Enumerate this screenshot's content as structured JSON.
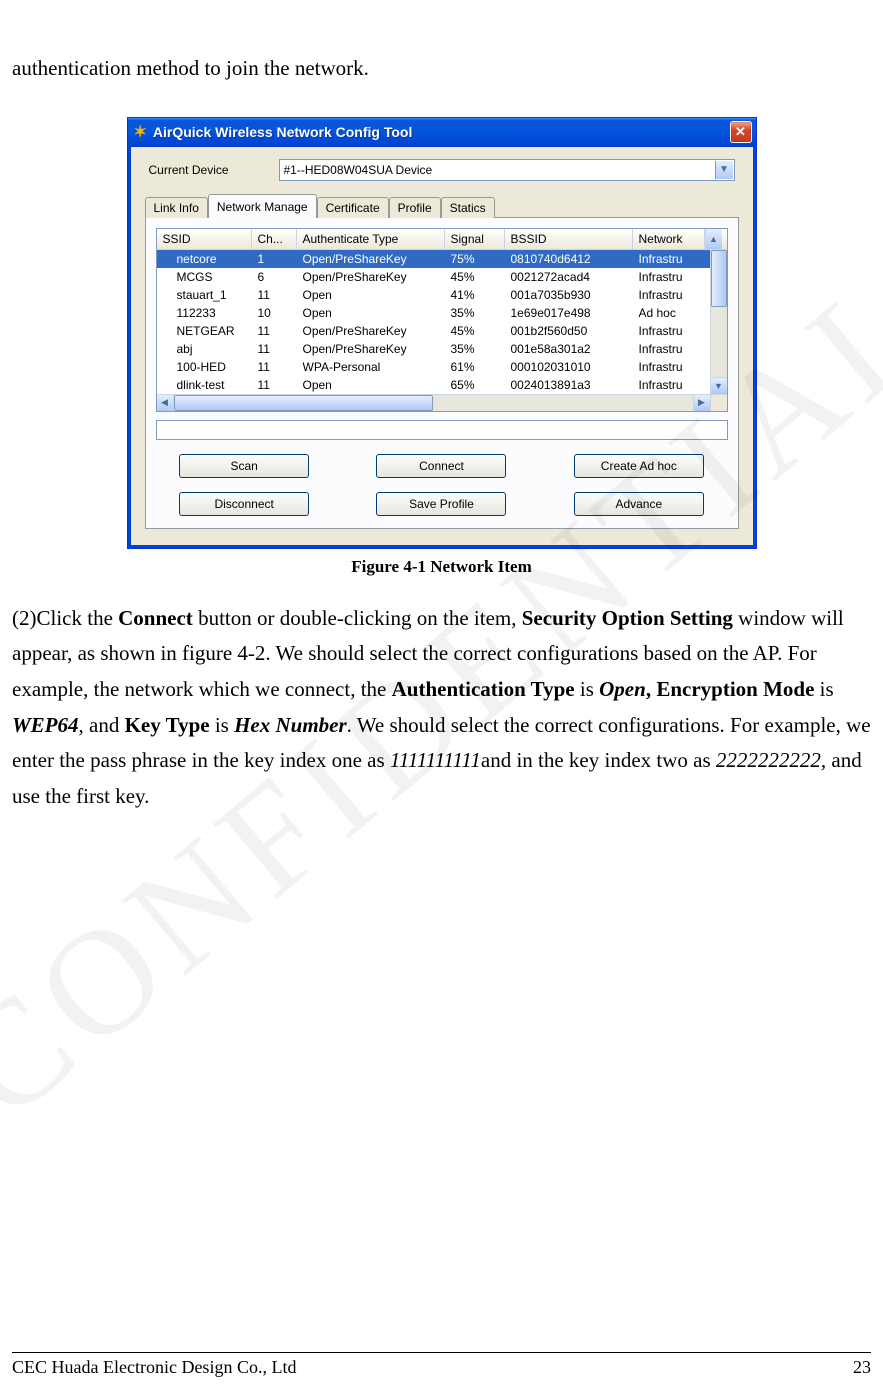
{
  "intro_text": "authentication method to join the network.",
  "window": {
    "title": "AirQuick Wireless Network Config Tool",
    "device_label": "Current Device",
    "device_value": "#1--HED08W04SUA Device",
    "tabs": [
      "Link Info",
      "Network Manage",
      "Certificate",
      "Profile",
      "Statics"
    ],
    "headers": {
      "ssid": "SSID",
      "ch": "Ch...",
      "auth": "Authenticate Type",
      "sig": "Signal",
      "bssid": "BSSID",
      "net": "Network"
    },
    "rows": [
      {
        "ssid": "netcore",
        "ch": "1",
        "auth": "Open/PreShareKey",
        "sig": "75%",
        "bssid": "0810740d6412",
        "net": "Infrastru",
        "sel": true
      },
      {
        "ssid": "MCGS",
        "ch": "6",
        "auth": "Open/PreShareKey",
        "sig": "45%",
        "bssid": "0021272acad4",
        "net": "Infrastru"
      },
      {
        "ssid": "stauart_1",
        "ch": "11",
        "auth": "Open",
        "sig": "41%",
        "bssid": "001a7035b930",
        "net": "Infrastru"
      },
      {
        "ssid": "112233",
        "ch": "10",
        "auth": "Open",
        "sig": "35%",
        "bssid": "1e69e017e498",
        "net": "Ad hoc"
      },
      {
        "ssid": "NETGEAR",
        "ch": "11",
        "auth": "Open/PreShareKey",
        "sig": "45%",
        "bssid": "001b2f560d50",
        "net": "Infrastru"
      },
      {
        "ssid": "abj",
        "ch": "11",
        "auth": "Open/PreShareKey",
        "sig": "35%",
        "bssid": "001e58a301a2",
        "net": "Infrastru"
      },
      {
        "ssid": "100-HED",
        "ch": "11",
        "auth": "WPA-Personal",
        "sig": "61%",
        "bssid": "000102031010",
        "net": "Infrastru"
      },
      {
        "ssid": "dlink-test",
        "ch": "11",
        "auth": "Open",
        "sig": "65%",
        "bssid": "0024013891a3",
        "net": "Infrastru"
      }
    ],
    "buttons": {
      "scan": "Scan",
      "connect": "Connect",
      "adhoc": "Create Ad hoc",
      "disconnect": "Disconnect",
      "save": "Save Profile",
      "advance": "Advance"
    }
  },
  "caption": "Figure 4-1 Network Item",
  "para2": {
    "p1a": "(2)Click the ",
    "b1": "Connect",
    "p1b": " button or double-clicking on the item, ",
    "b2": "Security Option Setting",
    "p2": " window will appear, as shown in figure 4-2. We should select the correct configurations based on the AP. For example, the network which we connect, the ",
    "b3": "Authentication Type",
    "p3": " is ",
    "i1": "Open",
    "b4": ", Encryption Mode",
    "p4": " is ",
    "i2": "WEP64",
    "p5": ", and ",
    "b5": "Key Type",
    "p6": " is ",
    "i3": "Hex Number",
    "p7": ". We should select the correct configurations. For example, we enter the pass phrase in the key index one as ",
    "i4": "1111111111",
    "p8": "and in the key index two as ",
    "i5": "2222222222",
    "p9": ", and use the first key."
  },
  "footer": {
    "left": "CEC Huada Electronic Design Co., Ltd",
    "right": "23"
  }
}
